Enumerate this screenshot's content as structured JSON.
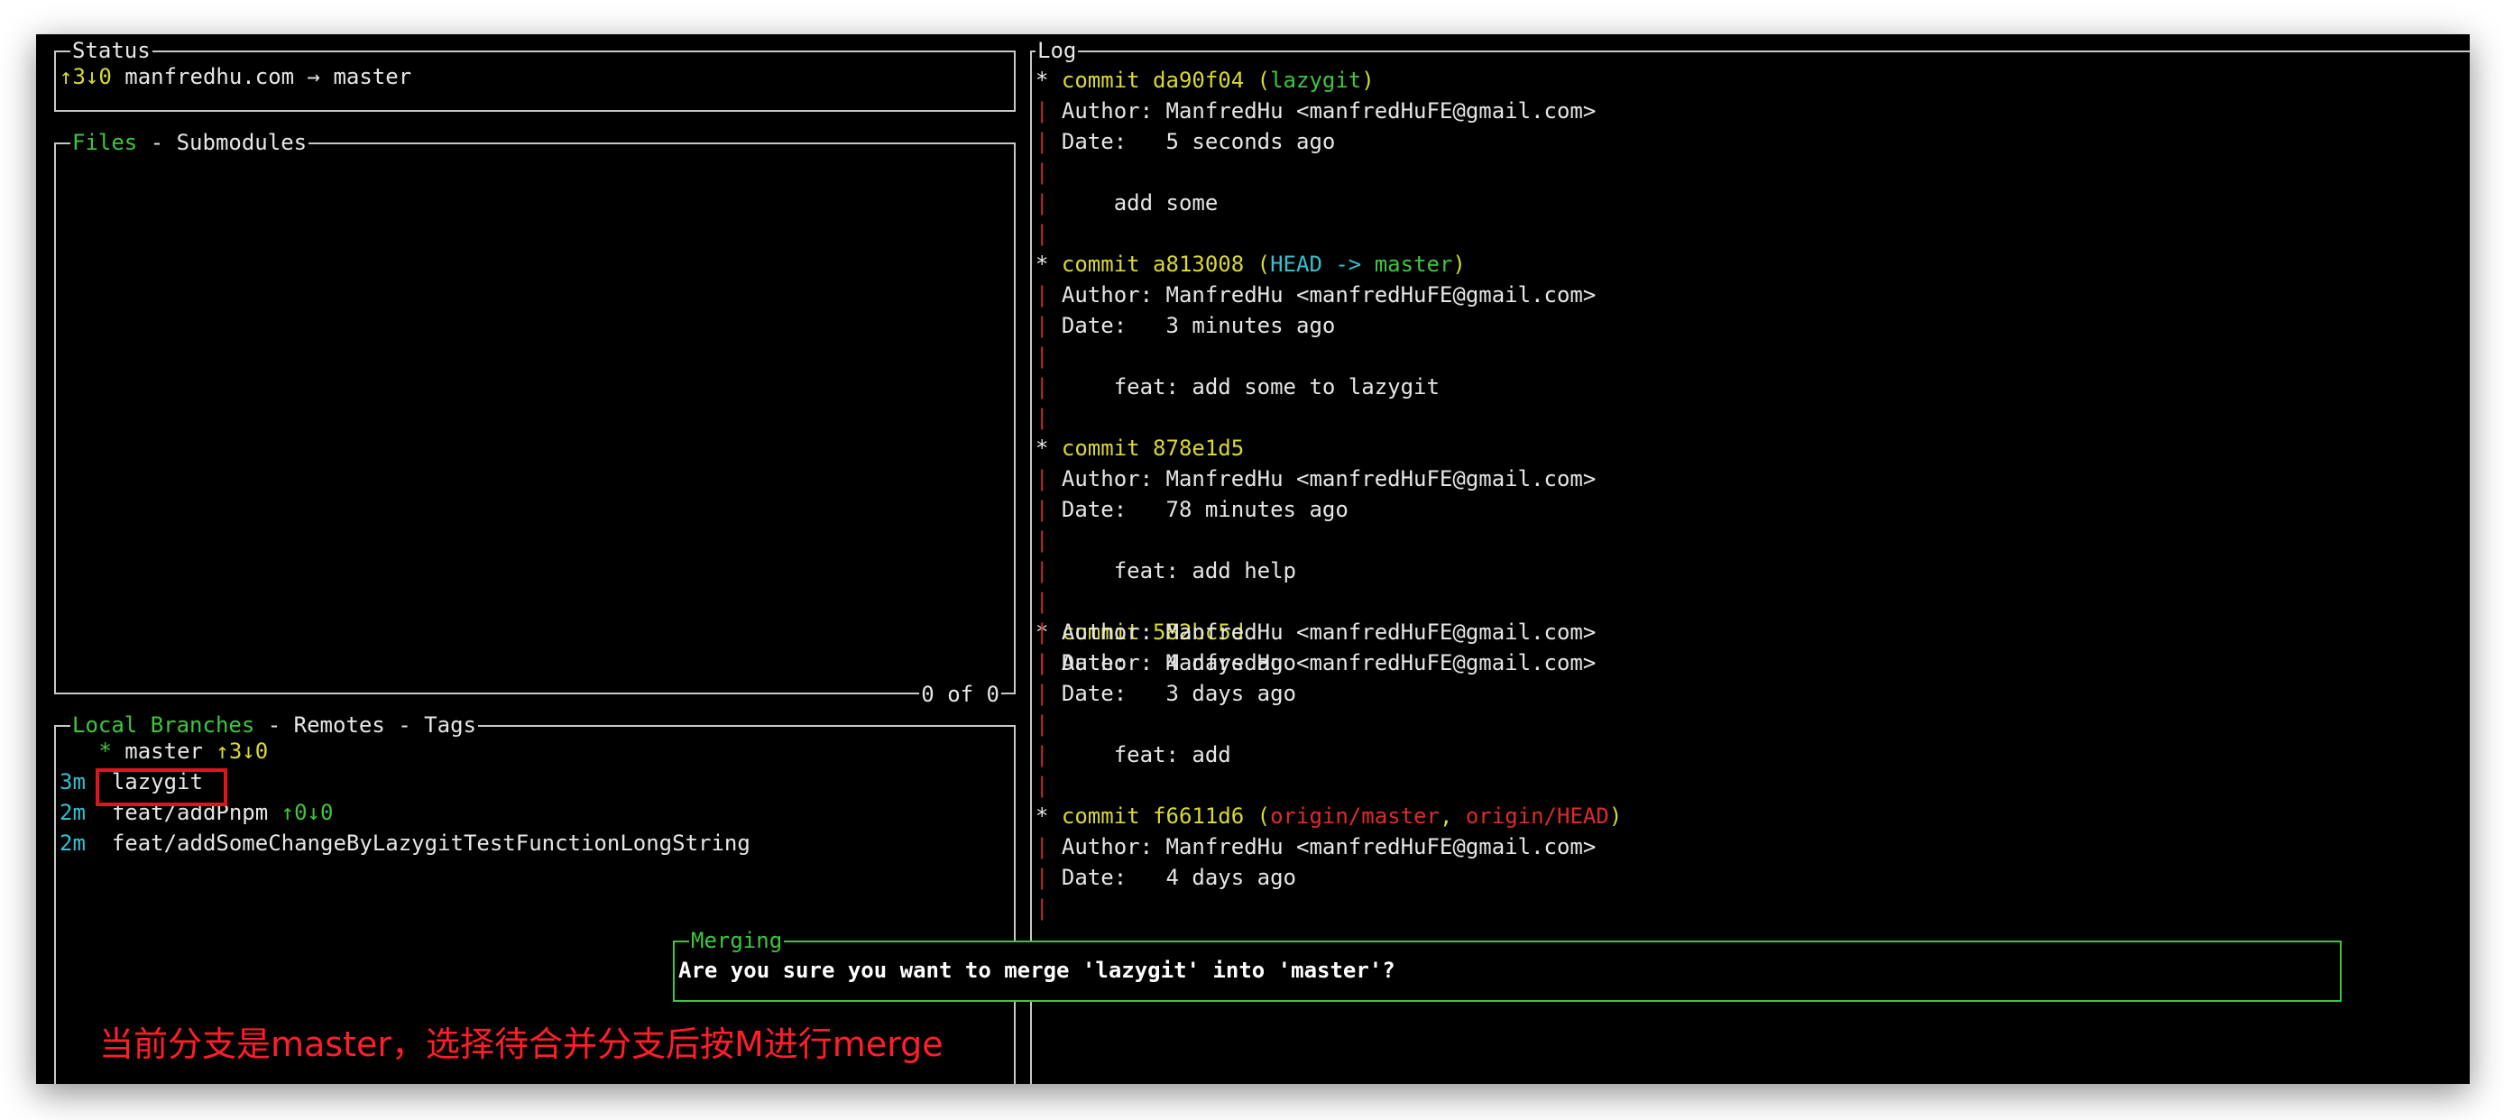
{
  "status": {
    "title": "Status",
    "arrows": "↑3↓0",
    "repo": "manfredhu.com",
    "arrow": "→",
    "branch": "master"
  },
  "files": {
    "title_active": "Files",
    "sep": " - ",
    "title_other": "Submodules",
    "count": "0 of 0"
  },
  "branches": {
    "title_active": "Local Branches",
    "sep1": " - ",
    "title_remotes": "Remotes",
    "sep2": " - ",
    "title_tags": "Tags",
    "items": [
      {
        "time": "",
        "marker": "*",
        "name": "master",
        "track": "↑3↓0"
      },
      {
        "time": "3m",
        "marker": "",
        "name": "lazygit",
        "track": ""
      },
      {
        "time": "2m",
        "marker": "",
        "name": "feat/addPnpm",
        "track": "↑0↓0"
      },
      {
        "time": "2m",
        "marker": "",
        "name": "feat/addSomeChangeByLazygitTestFunctionLongString",
        "track": ""
      }
    ]
  },
  "log": {
    "title": "Log",
    "commits": [
      {
        "star": "*",
        "label": "commit",
        "hash": "da90f04",
        "open": "(",
        "ref1": "lazygit",
        "ref1_color": "green",
        "comma": "",
        "ref2": "",
        "ref2_color": "",
        "close": ")",
        "author_label": "Author:",
        "author": "ManfredHu <manfredHuFE@gmail.com>",
        "date_label": "Date:",
        "date": "5 seconds ago",
        "message": "add some"
      },
      {
        "star": "*",
        "label": "commit",
        "hash": "a813008",
        "open": "(",
        "ref1": "HEAD ->",
        "ref1_color": "cyan",
        "comma": " ",
        "ref2": "master",
        "ref2_color": "green",
        "close": ")",
        "author_label": "Author:",
        "author": "ManfredHu <manfredHuFE@gmail.com>",
        "date_label": "Date:",
        "date": "3 minutes ago",
        "message": "feat: add some to lazygit"
      },
      {
        "star": "*",
        "label": "commit",
        "hash": "878e1d5",
        "open": "",
        "ref1": "",
        "ref1_color": "",
        "comma": "",
        "ref2": "",
        "ref2_color": "",
        "close": "",
        "author_label": "Author:",
        "author": "ManfredHu <manfredHuFE@gmail.com>",
        "date_label": "Date:",
        "date": "78 minutes ago",
        "message": "feat: add help"
      },
      {
        "star": "*",
        "label": "commit",
        "hash": "582bc5d",
        "open": "",
        "ref1": "",
        "ref1_color": "",
        "comma": "",
        "ref2": "",
        "ref2_color": "",
        "close": "",
        "author_label": "Author:",
        "author": "ManfredHu <manfredHuFE@gmail.com>",
        "date_label": "Date:",
        "date": "3 days ago",
        "message": "feat: add"
      },
      {
        "star": "*",
        "label": "commit",
        "hash": "f6611d6",
        "open": "(",
        "ref1": "origin/master",
        "ref1_color": "red",
        "comma": ", ",
        "ref2": "origin/HEAD",
        "ref2_color": "red",
        "close": ")",
        "author_label": "Author:",
        "author": "ManfredHu <manfredHuFE@gmail.com>",
        "date_label": "Date:",
        "date": "4 days ago",
        "message": ""
      }
    ],
    "tail": {
      "author_label": "Author:",
      "author": "ManfredHu <manfredHuFE@gmail.com>",
      "date_label": "Date:",
      "date": "4 days ago"
    }
  },
  "dialog": {
    "title": "Merging",
    "message": "Are you sure you want to merge 'lazygit' into 'master'?"
  },
  "annotation": "当前分支是master，选择待合并分支后按M进行merge",
  "colors": {
    "accent_green": "#3ec63e",
    "highlight_red": "#e0141e",
    "annotation_red": "#ff1e2a",
    "commit_yellow": "#d8d836"
  }
}
